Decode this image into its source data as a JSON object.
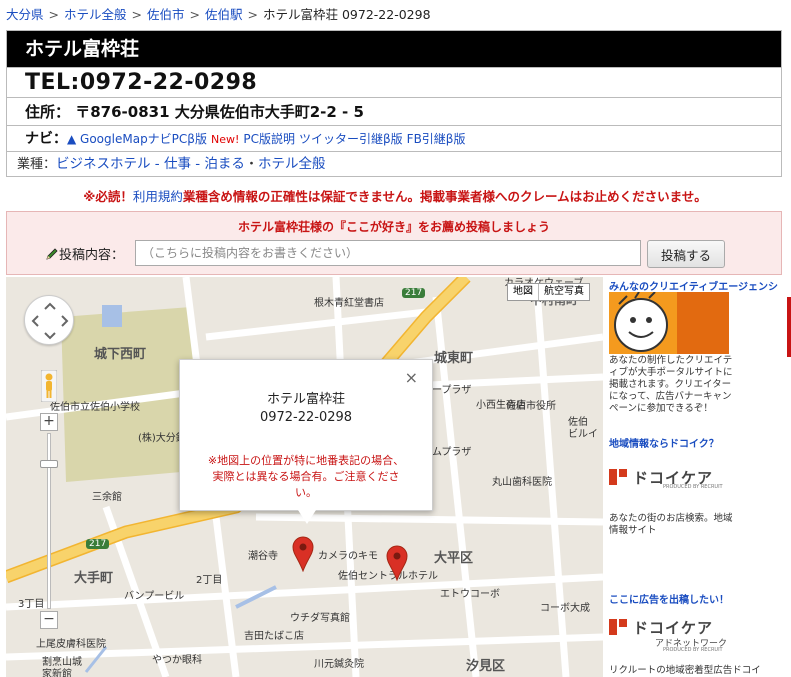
{
  "breadcrumb": {
    "items": [
      "大分県",
      "ホテル全般",
      "佐伯市",
      "佐伯駅"
    ],
    "current": "ホテル富枠荘 0972-22-0298",
    "separator": ">"
  },
  "header": {
    "title": "ホテル富枠荘",
    "tel": "TEL:0972-22-0298",
    "address": "住所： 〒876-0831 大分県佐伯市大手町2-2 - 5",
    "navi_label": "ナビ：",
    "navi_google": "▲ GoogleMapナビPCβ版",
    "navi_new": "New!",
    "navi_links": [
      "PC版説明",
      "ツイッター引継β版",
      "FB引継β版"
    ],
    "category_label": "業種：",
    "category_link": "ビジネスホテル - 仕事 - 泊まる",
    "category_dot": "・",
    "category_all": "ホテル全般"
  },
  "warning": {
    "prefix": "※必読！",
    "terms_link": "利用規約",
    "text": "業種含め情報の正確性は保証できません。掲載事業者様へのクレームはお止めくださいませ。"
  },
  "post": {
    "heading": "ホテル富枠荘様の『ここが好き』をお薦め投稿しましょう",
    "label": "投稿内容：",
    "placeholder": "（こちらに投稿内容をお書きください）",
    "button": "投稿する"
  },
  "map": {
    "type_buttons": [
      "地図",
      "航空写真"
    ],
    "labels": {
      "castle_west": "城下西町",
      "castle_east": "城東町",
      "otemachi": "大手町",
      "ohira": "大平区",
      "shiomi": "汐見区",
      "nichome": "2丁目",
      "sanchome": "3丁目",
      "school": "佐伯市立佐伯小学校",
      "daibun": "(株)大分銀",
      "nemoki": "根木青紅堂書店",
      "karaoke": "カラオケウェーブ",
      "nakamuraminami": "中村南町",
      "plaza": "ープラザ",
      "koyonagi": "小西生商店",
      "saiki_city": "佐伯市役所",
      "saiki_bldg": "佐伯\nビルイ",
      "mura_plaza": "ムプラザ",
      "maruyama": "丸山歯科医院",
      "sanjikan": "三余館",
      "choshoji": "潮谷寺",
      "camera": "カメラのキモ",
      "saiki_central": "佐伯セントラルホテル",
      "etoukobo": "エトウコーボ",
      "kobe_taisei": "コーボ大成",
      "banpubiru": "バンプービル",
      "uchiga": "ウチダ写真館",
      "yoshida": "吉田たばこ店",
      "kamio": "上尾皮膚科医院",
      "kawamoto": "川元鍼灸院",
      "yatsuga": "やつか眼科",
      "wappo": "割烹山城\n家新館",
      "route": "217"
    },
    "info": {
      "name": "ホテル富枠荘",
      "tel": "0972-22-0298",
      "note": "※地図上の位置が特に地番表記の場合、実際とは異なる場合有。ご注意ください。",
      "close": "×"
    }
  },
  "sidebar": {
    "ad1_title": "みんなのクリエイティブエージェンシ",
    "ad1_text": "あなたの制作したクリエイティブが大手ポータルサイトに掲載されます。クリエイターになって、広告バナーキャンペーンに参加できるぞ！",
    "ad2_title": "地域情報ならドコイク？",
    "ad2_logo": "ドコイケア",
    "ad2_sub": "PRODUCED BY RECRUIT",
    "ad2_text": "あなたの街のお店検索。地域情報サイト",
    "ad3_title": "ここに広告を出稿したい！",
    "ad3_logo": "ドコイケア",
    "ad3_sub": "アドネットワーク",
    "ad3_sub2": "PRODUCED BY RECRUIT",
    "ad3_text": "リクルートの地域密着型広告ドコイ"
  },
  "colors": {
    "link": "#1a4dc0",
    "warning": "#c81414",
    "pin": "#d93025",
    "road_major": "#f7c94a",
    "park": "#d8d7a9"
  }
}
